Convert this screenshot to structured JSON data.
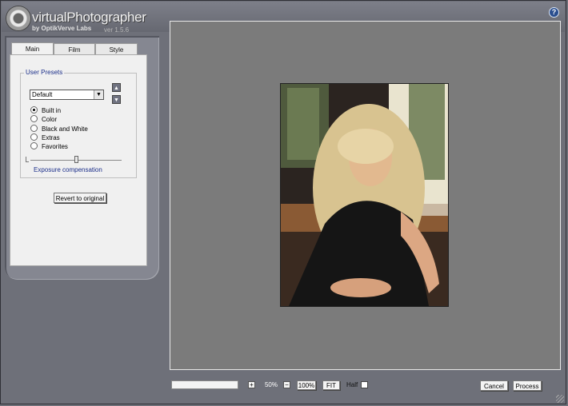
{
  "app": {
    "title": "virtualPhotographer",
    "subtitle": "by OptikVerve Labs",
    "version": "ver 1.5.6"
  },
  "tabs": [
    {
      "label": "Main",
      "active": true
    },
    {
      "label": "Film",
      "active": false
    },
    {
      "label": "Style",
      "active": false
    }
  ],
  "presets": {
    "group_title": "User Presets",
    "selected": "Default",
    "categories": [
      {
        "label": "Built in",
        "checked": true
      },
      {
        "label": "Color",
        "checked": false
      },
      {
        "label": "Black and White",
        "checked": false
      },
      {
        "label": "Extras",
        "checked": false
      },
      {
        "label": "Favorites",
        "checked": false
      }
    ],
    "exposure_label": "Exposure compensation",
    "exposure_level": 0.5
  },
  "buttons": {
    "revert": "Revert to original",
    "cancel": "Cancel",
    "process": "Process"
  },
  "zoom": {
    "plus": "+",
    "minus": "−",
    "value": "50%",
    "full": "100%",
    "fit": "FIT",
    "half_label": "Half"
  },
  "icons": {
    "help": "help-icon",
    "preset_up": "arrow-up-icon",
    "preset_down": "arrow-down-icon"
  }
}
